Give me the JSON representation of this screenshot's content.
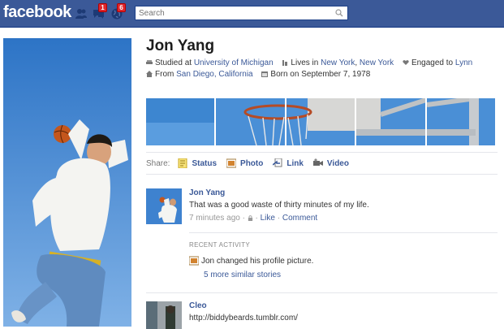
{
  "topbar": {
    "logo": "facebook",
    "friend_requests_icon": "friends-icon",
    "messages_icon": "messages-icon",
    "messages_count": "1",
    "notifications_icon": "globe-icon",
    "notifications_count": "6",
    "search_placeholder": "Search"
  },
  "profile": {
    "name": "Jon Yang",
    "studied_prefix": "Studied at",
    "studied_school": "University of Michigan",
    "lives_prefix": "Lives in",
    "lives_city": "New York",
    "lives_state": "New York",
    "engaged_prefix": "Engaged to",
    "engaged_to": "Lynn",
    "from_prefix": "From",
    "from_place": "San Diego, California",
    "born": "Born on September 7, 1978"
  },
  "share": {
    "label": "Share:",
    "options": [
      {
        "label": "Status",
        "icon": "status-icon"
      },
      {
        "label": "Photo",
        "icon": "photo-icon"
      },
      {
        "label": "Link",
        "icon": "link-icon"
      },
      {
        "label": "Video",
        "icon": "video-icon"
      }
    ]
  },
  "stories": [
    {
      "author": "Jon Yang",
      "text": "That was a good waste of thirty minutes of my life.",
      "time": "7 minutes ago",
      "like": "Like",
      "comment": "Comment"
    },
    {
      "author": "Cleo",
      "text": "http://biddybeards.tumblr.com/"
    }
  ],
  "recent": {
    "heading": "RECENT ACTIVITY",
    "item": "Jon changed his profile picture.",
    "more": "5 more similar stories"
  },
  "colors": {
    "brand": "#3b5998",
    "badge": "#e0262c"
  }
}
